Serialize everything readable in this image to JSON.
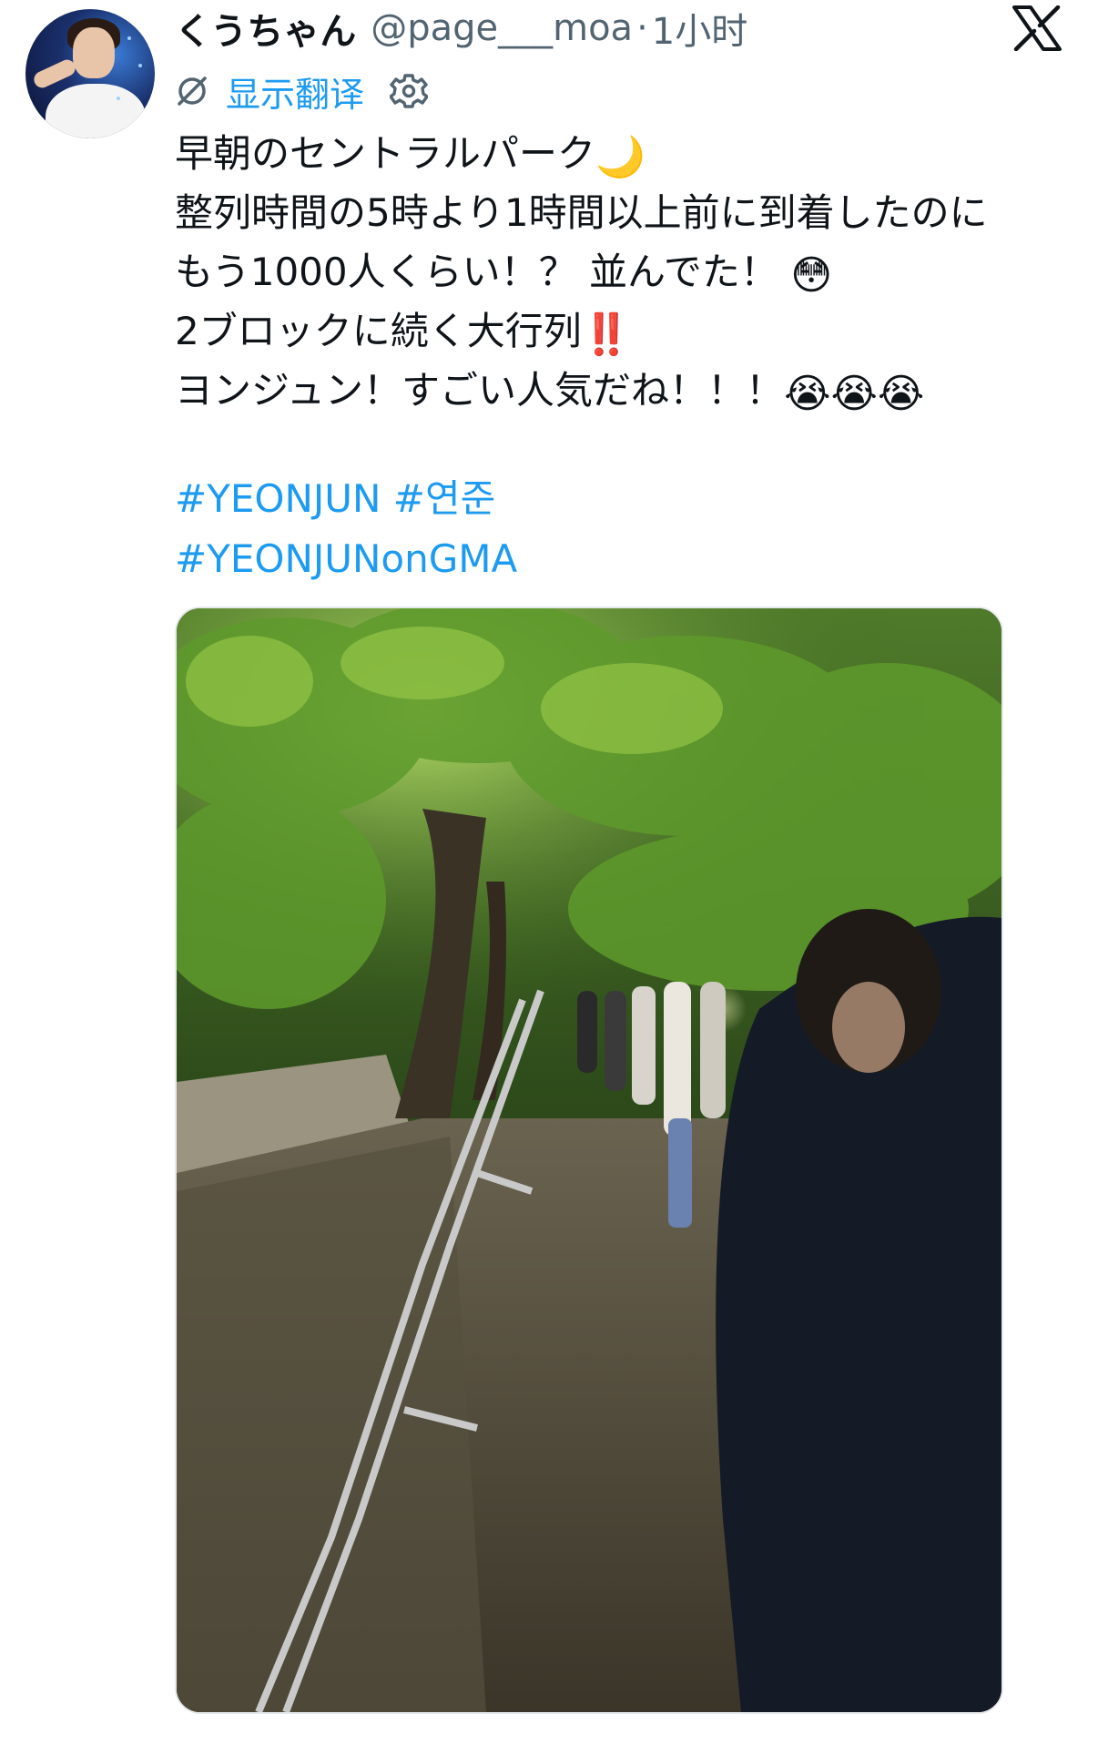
{
  "author": {
    "display_name": "くうちゃん",
    "handle": "@page___moa",
    "separator": "·",
    "time": "1小时"
  },
  "translate": {
    "label": "显示翻译"
  },
  "tweet": {
    "lines": [
      "早朝のセントラルパーク",
      "整列時間の5時より1時間以上前に到着したのに",
      "もう1000人くらい！？ 並んでた！",
      "2ブロックに続く大行列",
      "ヨンジュン！すごい人気だね！！！"
    ],
    "emoji_moon": "🌙",
    "emoji_flushed": "😳",
    "emoji_exclaim": "‼️",
    "emoji_crying": "😭😭😭",
    "hashtags_line1": "#YEONJUN #연준",
    "hashtags_line2": "#YEONJUNonGMA"
  },
  "colors": {
    "link": "#1d9bf0",
    "text": "#0f1419",
    "muted": "#536471"
  },
  "icons": [
    "x-logo-icon",
    "translate-icon",
    "gear-icon"
  ]
}
